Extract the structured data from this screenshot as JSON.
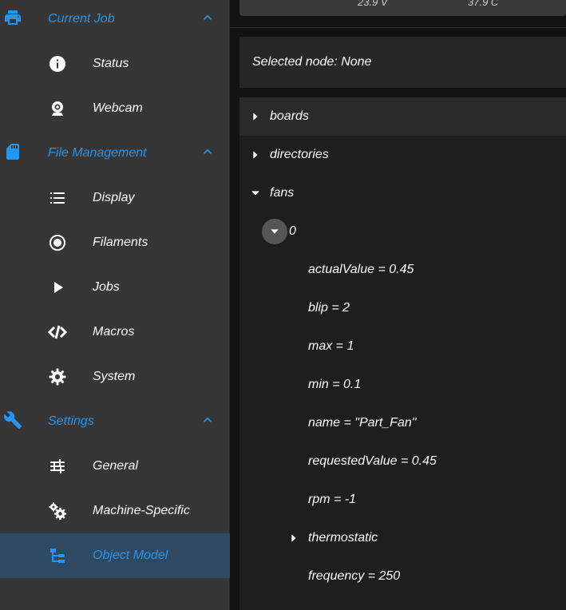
{
  "sidebar": {
    "groups": [
      {
        "label": "Current Job",
        "icon": "printer-icon",
        "items": [
          {
            "label": "Status",
            "icon": "info-icon"
          },
          {
            "label": "Webcam",
            "icon": "webcam-icon"
          }
        ]
      },
      {
        "label": "File Management",
        "icon": "sd-card-icon",
        "items": [
          {
            "label": "Display",
            "icon": "list-icon"
          },
          {
            "label": "Filaments",
            "icon": "radiobox-icon"
          },
          {
            "label": "Jobs",
            "icon": "play-icon"
          },
          {
            "label": "Macros",
            "icon": "code-icon"
          },
          {
            "label": "System",
            "icon": "gear-icon"
          }
        ]
      },
      {
        "label": "Settings",
        "icon": "wrench-icon",
        "items": [
          {
            "label": "General",
            "icon": "tune-icon"
          },
          {
            "label": "Machine-Specific",
            "icon": "cogs-icon"
          },
          {
            "label": "Object Model",
            "icon": "file-tree-icon",
            "active": true
          }
        ]
      }
    ],
    "accent_color": "#2196f3"
  },
  "status_bar": {
    "voltage": "23.9 V",
    "temperature": "37.9 C"
  },
  "selected_node": "Selected node: None",
  "tree": {
    "boards": "boards",
    "directories": "directories",
    "fans": "fans",
    "fan_index": "0",
    "props": [
      "actualValue = 0.45",
      "blip = 2",
      "max = 1",
      "min = 0.1",
      "name = \"Part_Fan\"",
      "requestedValue = 0.45",
      "rpm = -1"
    ],
    "thermostatic": "thermostatic",
    "frequency": "frequency = 250"
  }
}
